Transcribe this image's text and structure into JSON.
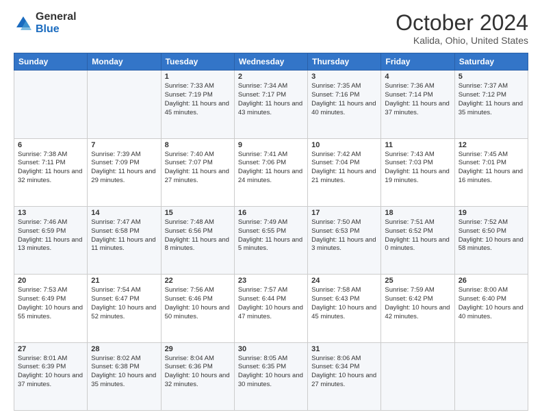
{
  "logo": {
    "general": "General",
    "blue": "Blue"
  },
  "header": {
    "month": "October 2024",
    "location": "Kalida, Ohio, United States"
  },
  "weekdays": [
    "Sunday",
    "Monday",
    "Tuesday",
    "Wednesday",
    "Thursday",
    "Friday",
    "Saturday"
  ],
  "weeks": [
    [
      {
        "day": "",
        "sunrise": "",
        "sunset": "",
        "daylight": ""
      },
      {
        "day": "",
        "sunrise": "",
        "sunset": "",
        "daylight": ""
      },
      {
        "day": "1",
        "sunrise": "Sunrise: 7:33 AM",
        "sunset": "Sunset: 7:19 PM",
        "daylight": "Daylight: 11 hours and 45 minutes."
      },
      {
        "day": "2",
        "sunrise": "Sunrise: 7:34 AM",
        "sunset": "Sunset: 7:17 PM",
        "daylight": "Daylight: 11 hours and 43 minutes."
      },
      {
        "day": "3",
        "sunrise": "Sunrise: 7:35 AM",
        "sunset": "Sunset: 7:16 PM",
        "daylight": "Daylight: 11 hours and 40 minutes."
      },
      {
        "day": "4",
        "sunrise": "Sunrise: 7:36 AM",
        "sunset": "Sunset: 7:14 PM",
        "daylight": "Daylight: 11 hours and 37 minutes."
      },
      {
        "day": "5",
        "sunrise": "Sunrise: 7:37 AM",
        "sunset": "Sunset: 7:12 PM",
        "daylight": "Daylight: 11 hours and 35 minutes."
      }
    ],
    [
      {
        "day": "6",
        "sunrise": "Sunrise: 7:38 AM",
        "sunset": "Sunset: 7:11 PM",
        "daylight": "Daylight: 11 hours and 32 minutes."
      },
      {
        "day": "7",
        "sunrise": "Sunrise: 7:39 AM",
        "sunset": "Sunset: 7:09 PM",
        "daylight": "Daylight: 11 hours and 29 minutes."
      },
      {
        "day": "8",
        "sunrise": "Sunrise: 7:40 AM",
        "sunset": "Sunset: 7:07 PM",
        "daylight": "Daylight: 11 hours and 27 minutes."
      },
      {
        "day": "9",
        "sunrise": "Sunrise: 7:41 AM",
        "sunset": "Sunset: 7:06 PM",
        "daylight": "Daylight: 11 hours and 24 minutes."
      },
      {
        "day": "10",
        "sunrise": "Sunrise: 7:42 AM",
        "sunset": "Sunset: 7:04 PM",
        "daylight": "Daylight: 11 hours and 21 minutes."
      },
      {
        "day": "11",
        "sunrise": "Sunrise: 7:43 AM",
        "sunset": "Sunset: 7:03 PM",
        "daylight": "Daylight: 11 hours and 19 minutes."
      },
      {
        "day": "12",
        "sunrise": "Sunrise: 7:45 AM",
        "sunset": "Sunset: 7:01 PM",
        "daylight": "Daylight: 11 hours and 16 minutes."
      }
    ],
    [
      {
        "day": "13",
        "sunrise": "Sunrise: 7:46 AM",
        "sunset": "Sunset: 6:59 PM",
        "daylight": "Daylight: 11 hours and 13 minutes."
      },
      {
        "day": "14",
        "sunrise": "Sunrise: 7:47 AM",
        "sunset": "Sunset: 6:58 PM",
        "daylight": "Daylight: 11 hours and 11 minutes."
      },
      {
        "day": "15",
        "sunrise": "Sunrise: 7:48 AM",
        "sunset": "Sunset: 6:56 PM",
        "daylight": "Daylight: 11 hours and 8 minutes."
      },
      {
        "day": "16",
        "sunrise": "Sunrise: 7:49 AM",
        "sunset": "Sunset: 6:55 PM",
        "daylight": "Daylight: 11 hours and 5 minutes."
      },
      {
        "day": "17",
        "sunrise": "Sunrise: 7:50 AM",
        "sunset": "Sunset: 6:53 PM",
        "daylight": "Daylight: 11 hours and 3 minutes."
      },
      {
        "day": "18",
        "sunrise": "Sunrise: 7:51 AM",
        "sunset": "Sunset: 6:52 PM",
        "daylight": "Daylight: 11 hours and 0 minutes."
      },
      {
        "day": "19",
        "sunrise": "Sunrise: 7:52 AM",
        "sunset": "Sunset: 6:50 PM",
        "daylight": "Daylight: 10 hours and 58 minutes."
      }
    ],
    [
      {
        "day": "20",
        "sunrise": "Sunrise: 7:53 AM",
        "sunset": "Sunset: 6:49 PM",
        "daylight": "Daylight: 10 hours and 55 minutes."
      },
      {
        "day": "21",
        "sunrise": "Sunrise: 7:54 AM",
        "sunset": "Sunset: 6:47 PM",
        "daylight": "Daylight: 10 hours and 52 minutes."
      },
      {
        "day": "22",
        "sunrise": "Sunrise: 7:56 AM",
        "sunset": "Sunset: 6:46 PM",
        "daylight": "Daylight: 10 hours and 50 minutes."
      },
      {
        "day": "23",
        "sunrise": "Sunrise: 7:57 AM",
        "sunset": "Sunset: 6:44 PM",
        "daylight": "Daylight: 10 hours and 47 minutes."
      },
      {
        "day": "24",
        "sunrise": "Sunrise: 7:58 AM",
        "sunset": "Sunset: 6:43 PM",
        "daylight": "Daylight: 10 hours and 45 minutes."
      },
      {
        "day": "25",
        "sunrise": "Sunrise: 7:59 AM",
        "sunset": "Sunset: 6:42 PM",
        "daylight": "Daylight: 10 hours and 42 minutes."
      },
      {
        "day": "26",
        "sunrise": "Sunrise: 8:00 AM",
        "sunset": "Sunset: 6:40 PM",
        "daylight": "Daylight: 10 hours and 40 minutes."
      }
    ],
    [
      {
        "day": "27",
        "sunrise": "Sunrise: 8:01 AM",
        "sunset": "Sunset: 6:39 PM",
        "daylight": "Daylight: 10 hours and 37 minutes."
      },
      {
        "day": "28",
        "sunrise": "Sunrise: 8:02 AM",
        "sunset": "Sunset: 6:38 PM",
        "daylight": "Daylight: 10 hours and 35 minutes."
      },
      {
        "day": "29",
        "sunrise": "Sunrise: 8:04 AM",
        "sunset": "Sunset: 6:36 PM",
        "daylight": "Daylight: 10 hours and 32 minutes."
      },
      {
        "day": "30",
        "sunrise": "Sunrise: 8:05 AM",
        "sunset": "Sunset: 6:35 PM",
        "daylight": "Daylight: 10 hours and 30 minutes."
      },
      {
        "day": "31",
        "sunrise": "Sunrise: 8:06 AM",
        "sunset": "Sunset: 6:34 PM",
        "daylight": "Daylight: 10 hours and 27 minutes."
      },
      {
        "day": "",
        "sunrise": "",
        "sunset": "",
        "daylight": ""
      },
      {
        "day": "",
        "sunrise": "",
        "sunset": "",
        "daylight": ""
      }
    ]
  ]
}
